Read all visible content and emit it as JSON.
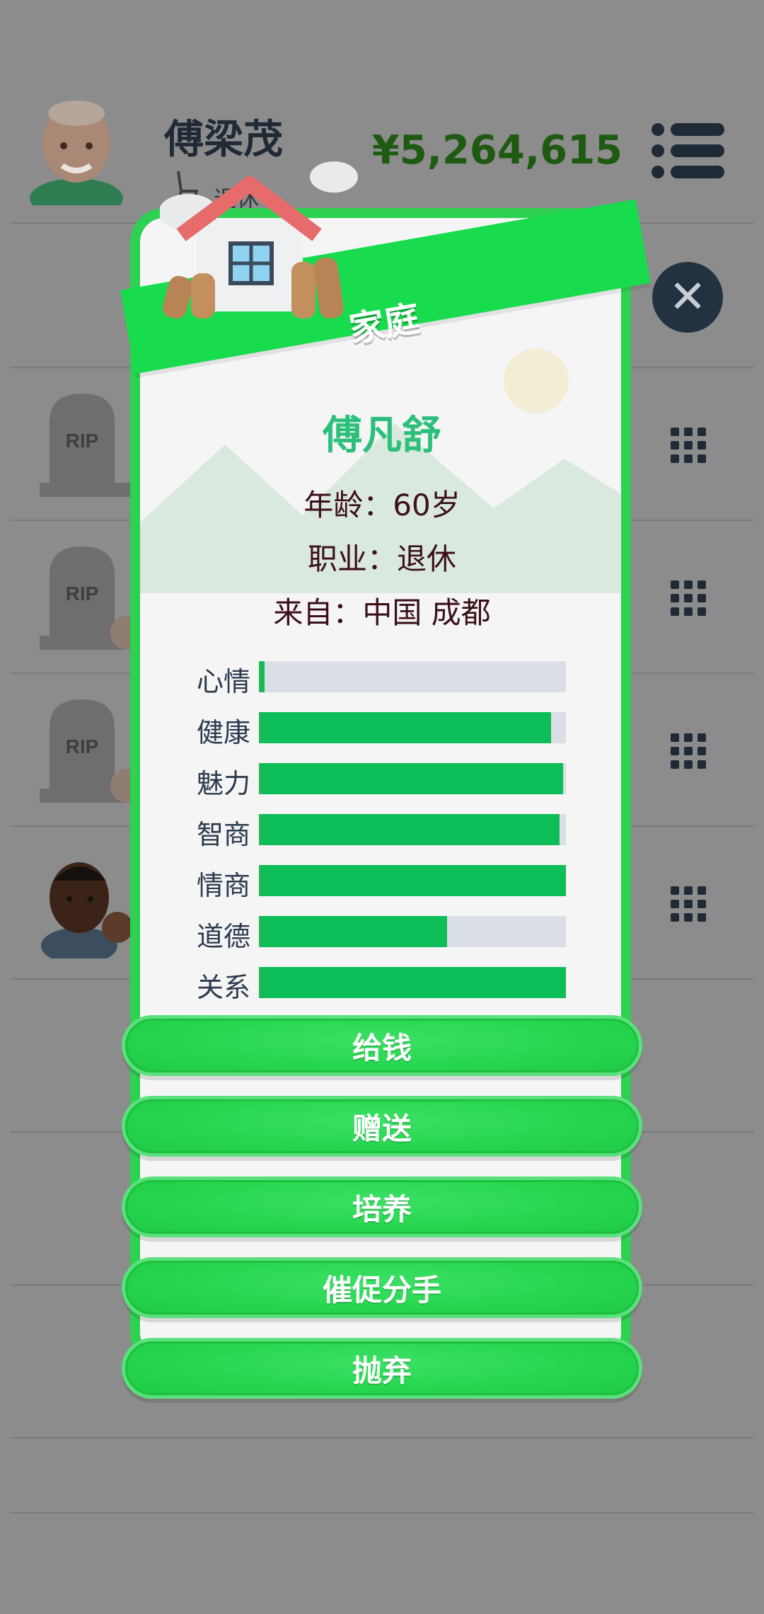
{
  "header": {
    "player_name": "傅梁茂",
    "player_job": "退休",
    "money": "¥5,264,615"
  },
  "list": {
    "grave_label": "RIP"
  },
  "modal": {
    "title": "家庭",
    "person_name": "傅凡舒",
    "age_line": "年龄：60岁",
    "job_line": "职业：退休",
    "from_line": "来自：中国 成都",
    "stats": [
      {
        "label": "心情",
        "value": 0.01
      },
      {
        "label": "健康",
        "value": 0.95
      },
      {
        "label": "魅力",
        "value": 0.99
      },
      {
        "label": "智商",
        "value": 0.98
      },
      {
        "label": "情商",
        "value": 1.0
      },
      {
        "label": "道德",
        "value": 0.61
      },
      {
        "label": "关系",
        "value": 1.0
      }
    ],
    "actions": [
      "给钱",
      "赠送",
      "培养",
      "催促分手",
      "抛弃"
    ]
  },
  "colors": {
    "accent_green": "#18dc4e",
    "bar_fill": "#0dbd57",
    "bar_track": "#d9dfe5",
    "name_teal": "#2cbf7c",
    "money_green": "#1f5a12"
  }
}
